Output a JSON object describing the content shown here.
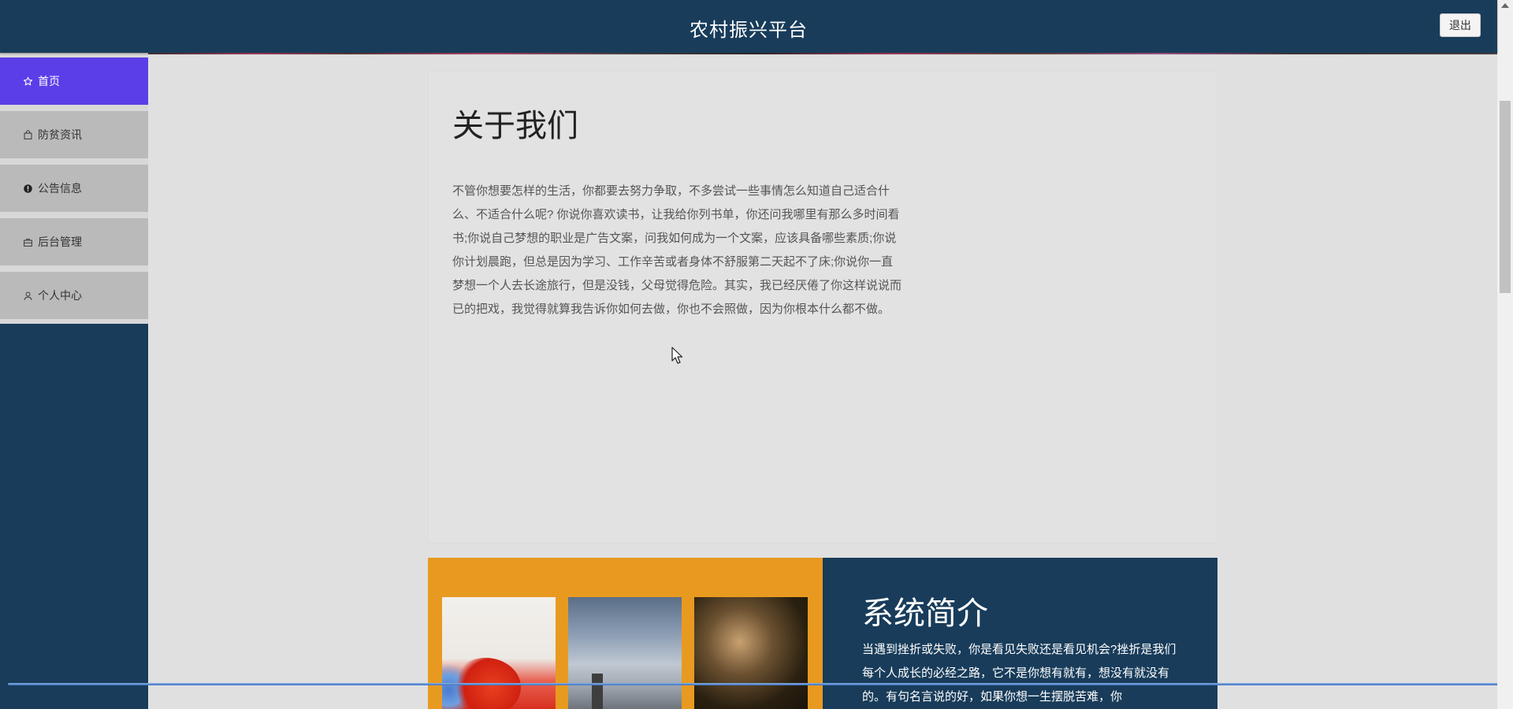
{
  "header": {
    "title": "农村振兴平台",
    "logout_label": "退出"
  },
  "sidebar": {
    "items": [
      {
        "label": "首页",
        "icon": "star-icon",
        "active": true
      },
      {
        "label": "防贫资讯",
        "icon": "bag-icon",
        "active": false
      },
      {
        "label": "公告信息",
        "icon": "info-icon",
        "active": false
      },
      {
        "label": "后台管理",
        "icon": "briefcase-icon",
        "active": false
      },
      {
        "label": "个人中心",
        "icon": "user-icon",
        "active": false
      }
    ]
  },
  "about": {
    "title": "关于我们",
    "text": "不管你想要怎样的生活，你都要去努力争取，不多尝试一些事情怎么知道自己适合什么、不适合什么呢? 你说你喜欢读书，让我给你列书单，你还问我哪里有那么多时间看书;你说自己梦想的职业是广告文案，问我如何成为一个文案，应该具备哪些素质;你说你计划晨跑，但总是因为学习、工作辛苦或者身体不舒服第二天起不了床;你说你一直梦想一个人去长途旅行，但是没钱，父母觉得危险。其实，我已经厌倦了你这样说说而已的把戏，我觉得就算我告诉你如何去做，你也不会照做，因为你根本什么都不做。"
  },
  "intro": {
    "title": "系统简介",
    "text": "当遇到挫折或失败，你是看见失败还是看见机会?挫折是我们每个人成长的必经之路，它不是你想有就有，想没有就没有的。有句名言说的好，如果你想一生摆脱苦难，你"
  },
  "colors": {
    "header_bg": "#183c5a",
    "active_menu": "#5c3ee8",
    "accent_orange": "#e89a20"
  }
}
